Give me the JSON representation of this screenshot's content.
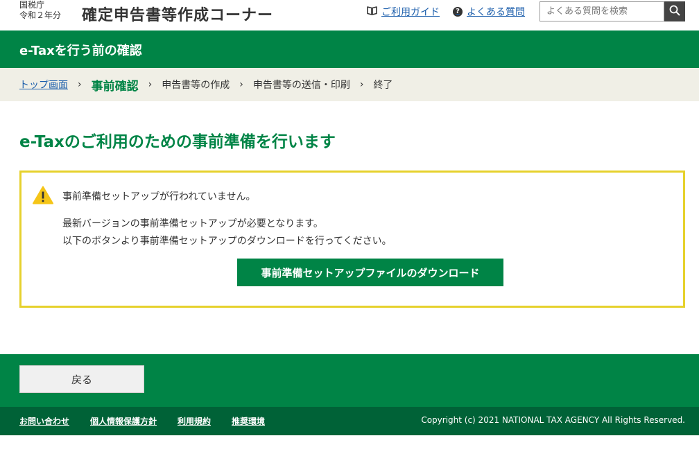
{
  "header": {
    "agency_line1": "国税庁",
    "agency_line2": "令和２年分",
    "site_title": "確定申告書等作成コーナー",
    "guide_link": "ご利用ガイド",
    "faq_link": "よくある質問",
    "search_placeholder": "よくある質問を検索",
    "faq_icon_text": "?"
  },
  "banner": {
    "title": "e-Taxを行う前の確認"
  },
  "breadcrumb": {
    "items": [
      "トップ画面",
      "事前確認",
      "申告書等の作成",
      "申告書等の送信・印刷",
      "終了"
    ],
    "separator": "›"
  },
  "main": {
    "heading": "e-Taxのご利用のための事前準備を行います",
    "alert": {
      "line1": "事前準備セットアップが行われていません。",
      "line2": "最新バージョンの事前準備セットアップが必要となります。",
      "line3": "以下のボタンより事前準備セットアップのダウンロードを行ってください。",
      "download_button": "事前準備セットアップファイルのダウンロード"
    }
  },
  "footer": {
    "back_button": "戻る",
    "links": [
      "お問い合わせ",
      "個人情報保護方針",
      "利用規約",
      "推奨環境"
    ],
    "copyright": "Copyright (c) 2021 NATIONAL TAX AGENCY All Rights Reserved."
  },
  "colors": {
    "brand_green": "#008446",
    "dark_green": "#006237",
    "alert_border": "#e6d12c",
    "warning_yellow": "#f5c518",
    "link_blue": "#1a5dab"
  },
  "icons": {
    "guide": "book-icon",
    "faq": "question-circle-icon",
    "search": "magnifier-icon",
    "warning": "warning-triangle-icon"
  }
}
